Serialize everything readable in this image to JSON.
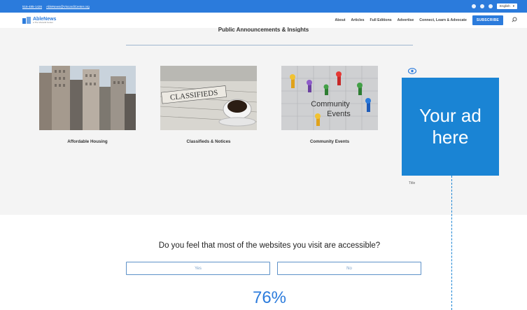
{
  "topbar": {
    "phone": "516-485-1426",
    "email": "AbleNews@ViscardiCenter.org",
    "language": "English"
  },
  "header": {
    "logo_brand": "AbleNews",
    "logo_sub": "a The Viscardi Center",
    "nav": [
      "About",
      "Articles",
      "Full Editions",
      "Advertise",
      "Connect, Learn & Advocate"
    ],
    "subscribe": "SUBSCRIBE"
  },
  "section": {
    "title": "Public Announcements & Insights"
  },
  "cards": [
    {
      "caption": "Affordable Housing"
    },
    {
      "caption": "Classifieds & Notices",
      "image_text": "CLASSIFIEDS"
    },
    {
      "caption": "Community Events",
      "image_text_1": "Community",
      "image_text_2": "Events"
    }
  ],
  "ad": {
    "line1": "Your ad",
    "line2": "here"
  },
  "side": {
    "title": "Title"
  },
  "poll": {
    "question": "Do you feel that most of the websites you visit are accessible?",
    "yes": "Yes",
    "no": "No",
    "percent": "76%"
  },
  "colors": {
    "accent": "#2b7bdc",
    "ad_blue": "#1a84d4"
  }
}
